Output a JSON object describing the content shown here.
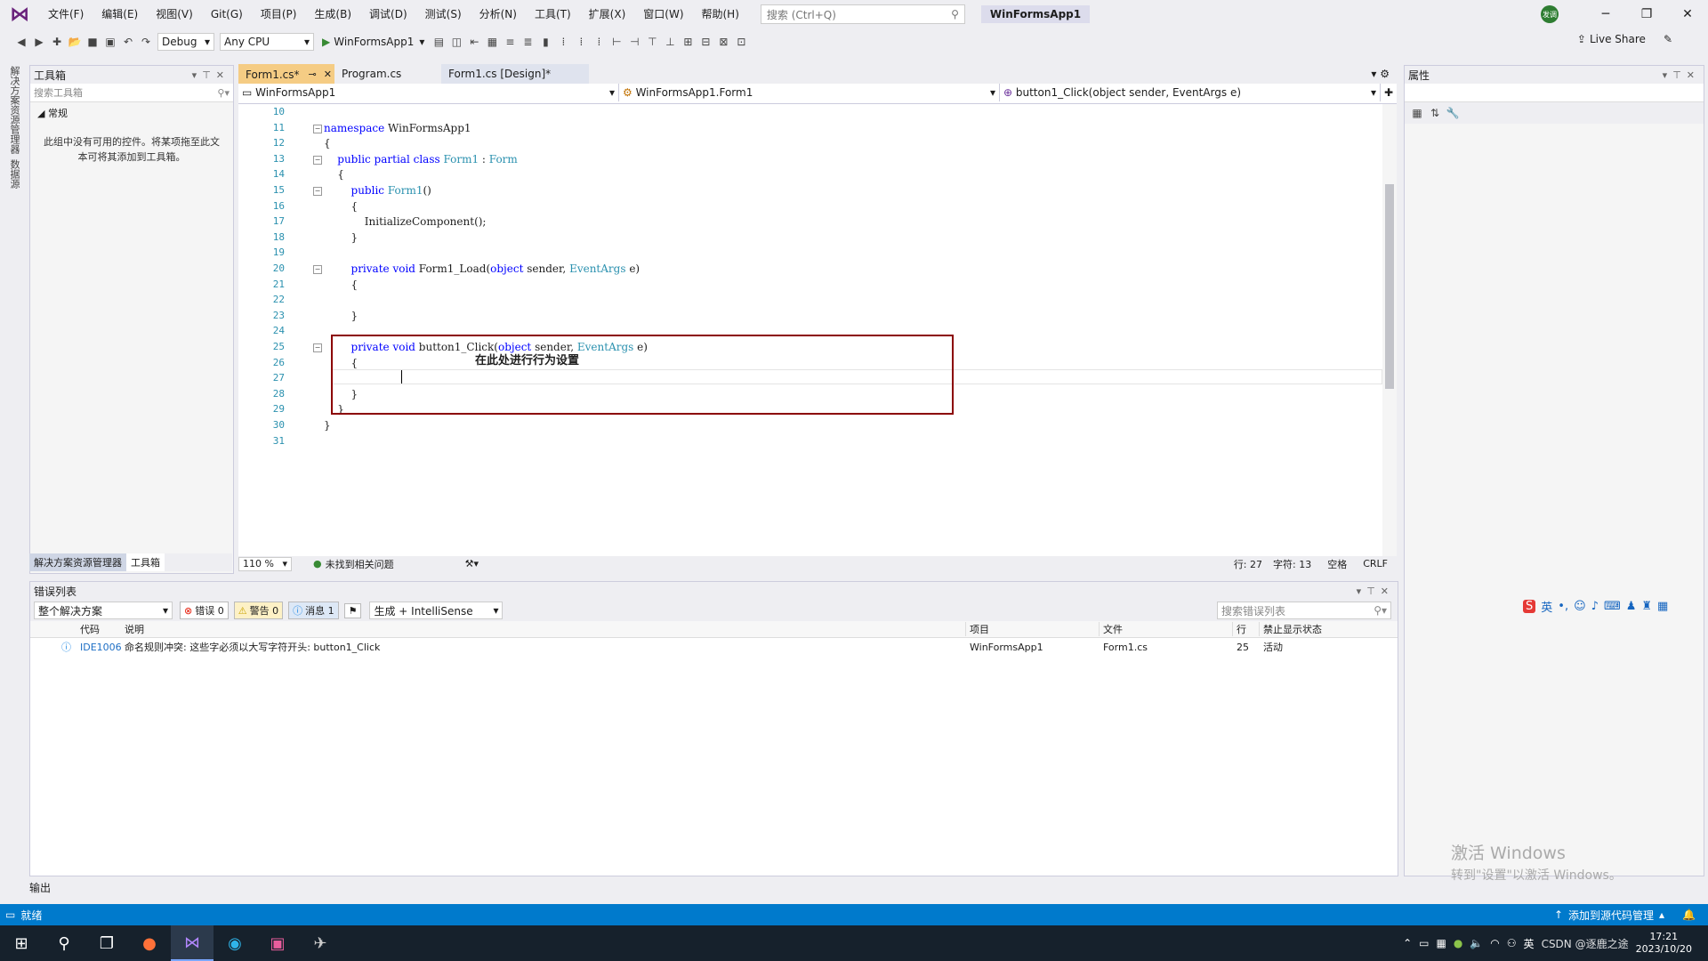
{
  "titlebar": {
    "menu": [
      "文件(F)",
      "编辑(E)",
      "视图(V)",
      "Git(G)",
      "项目(P)",
      "生成(B)",
      "调试(D)",
      "测试(S)",
      "分析(N)",
      "工具(T)",
      "扩展(X)",
      "窗口(W)",
      "帮助(H)"
    ],
    "search_placeholder": "搜索 (Ctrl+Q)",
    "app_title": "WinFormsApp1",
    "avatar_text": "发调"
  },
  "toolbar": {
    "config": "Debug",
    "platform": "Any CPU",
    "run_target": "WinFormsApp1",
    "live_share": "Live Share"
  },
  "left_strip": {
    "tabs": [
      "解决方案资源管理器",
      "数据源"
    ]
  },
  "toolbox": {
    "title": "工具箱",
    "search_placeholder": "搜索工具箱",
    "group": "常规",
    "empty_text": "此组中没有可用的控件。将某项拖至此文本可将其添加到工具箱。",
    "bottom_tabs": [
      "解决方案资源管理器",
      "工具箱"
    ]
  },
  "editor": {
    "tabs": [
      {
        "label": "Form1.cs*",
        "active": true
      },
      {
        "label": "Program.cs",
        "active": false
      },
      {
        "label": "Form1.cs [Design]*",
        "active": false
      }
    ],
    "nav": {
      "project": "WinFormsApp1",
      "class": "WinFormsApp1.Form1",
      "member": "button1_Click(object sender, EventArgs e)"
    },
    "lines": [
      {
        "n": "10",
        "parts": []
      },
      {
        "n": "11",
        "parts": [
          {
            "t": "namespace",
            "c": "kw"
          },
          {
            "t": " WinFormsApp1",
            "c": ""
          }
        ]
      },
      {
        "n": "12",
        "parts": [
          {
            "t": "{",
            "c": ""
          }
        ]
      },
      {
        "n": "13",
        "parts": [
          {
            "t": "    public partial class ",
            "c": "kw"
          },
          {
            "t": "Form1",
            "c": "ty"
          },
          {
            "t": " : ",
            "c": ""
          },
          {
            "t": "Form",
            "c": "ty"
          }
        ]
      },
      {
        "n": "14",
        "parts": [
          {
            "t": "    {",
            "c": ""
          }
        ]
      },
      {
        "n": "15",
        "parts": [
          {
            "t": "        public ",
            "c": "kw"
          },
          {
            "t": "Form1",
            "c": "ty"
          },
          {
            "t": "()",
            "c": ""
          }
        ]
      },
      {
        "n": "16",
        "parts": [
          {
            "t": "        {",
            "c": ""
          }
        ]
      },
      {
        "n": "17",
        "parts": [
          {
            "t": "            InitializeComponent();",
            "c": ""
          }
        ]
      },
      {
        "n": "18",
        "parts": [
          {
            "t": "        }",
            "c": ""
          }
        ]
      },
      {
        "n": "19",
        "parts": []
      },
      {
        "n": "20",
        "parts": [
          {
            "t": "        private void ",
            "c": "kw"
          },
          {
            "t": "Form1_Load(",
            "c": ""
          },
          {
            "t": "object",
            "c": "kw"
          },
          {
            "t": " sender, ",
            "c": ""
          },
          {
            "t": "EventArgs",
            "c": "ty"
          },
          {
            "t": " e)",
            "c": ""
          }
        ]
      },
      {
        "n": "21",
        "parts": [
          {
            "t": "        {",
            "c": ""
          }
        ]
      },
      {
        "n": "22",
        "parts": []
      },
      {
        "n": "23",
        "parts": [
          {
            "t": "        }",
            "c": ""
          }
        ]
      },
      {
        "n": "24",
        "parts": []
      },
      {
        "n": "25",
        "parts": [
          {
            "t": "        private void ",
            "c": "kw"
          },
          {
            "t": "button1_Click(",
            "c": ""
          },
          {
            "t": "object",
            "c": "kw"
          },
          {
            "t": " sender, ",
            "c": ""
          },
          {
            "t": "EventArgs",
            "c": "ty"
          },
          {
            "t": " e)",
            "c": ""
          }
        ]
      },
      {
        "n": "26",
        "parts": [
          {
            "t": "        {",
            "c": ""
          }
        ]
      },
      {
        "n": "27",
        "parts": []
      },
      {
        "n": "28",
        "parts": [
          {
            "t": "        }",
            "c": ""
          }
        ]
      },
      {
        "n": "29",
        "parts": [
          {
            "t": "    }",
            "c": ""
          }
        ]
      },
      {
        "n": "30",
        "parts": [
          {
            "t": "}",
            "c": ""
          }
        ]
      },
      {
        "n": "31",
        "parts": []
      }
    ],
    "annotation": "在此处进行行为设置",
    "status": {
      "zoom": "110 %",
      "issues": "未找到相关问题",
      "line": "行: 27",
      "char": "字符: 13",
      "spaces": "空格",
      "eol": "CRLF"
    }
  },
  "error_list": {
    "title": "错误列表",
    "scope": "整个解决方案",
    "errors_label": "错误 0",
    "warnings_label": "警告 0",
    "messages_label": "消息 1",
    "build_filter": "生成 + IntelliSense",
    "search_placeholder": "搜索错误列表",
    "columns": [
      "代码",
      "说明",
      "项目",
      "文件",
      "行",
      "禁止显示状态"
    ],
    "rows": [
      {
        "code": "IDE1006",
        "desc": "命名规则冲突: 这些字必须以大写字符开头: button1_Click",
        "project": "WinFormsApp1",
        "file": "Form1.cs",
        "line": "25",
        "state": "活动"
      }
    ]
  },
  "properties": {
    "title": "属性",
    "watermark_line1": "激活 Windows",
    "watermark_line2": "转到\"设置\"以激活 Windows。"
  },
  "ime": {
    "lang": "英"
  },
  "output_label": "输出",
  "statusbar": {
    "ready": "就绪",
    "source_control": "添加到源代码管理"
  },
  "taskbar": {
    "time": "17:21",
    "date": "2023/10/20",
    "ime": "英",
    "csdn": "CSDN @逐鹿之途"
  },
  "colors": {
    "accent": "#007acc",
    "active_tab": "#f5cc84",
    "highlight_box": "#8b0000",
    "keyword": "#0000ff",
    "type": "#2b91af"
  }
}
